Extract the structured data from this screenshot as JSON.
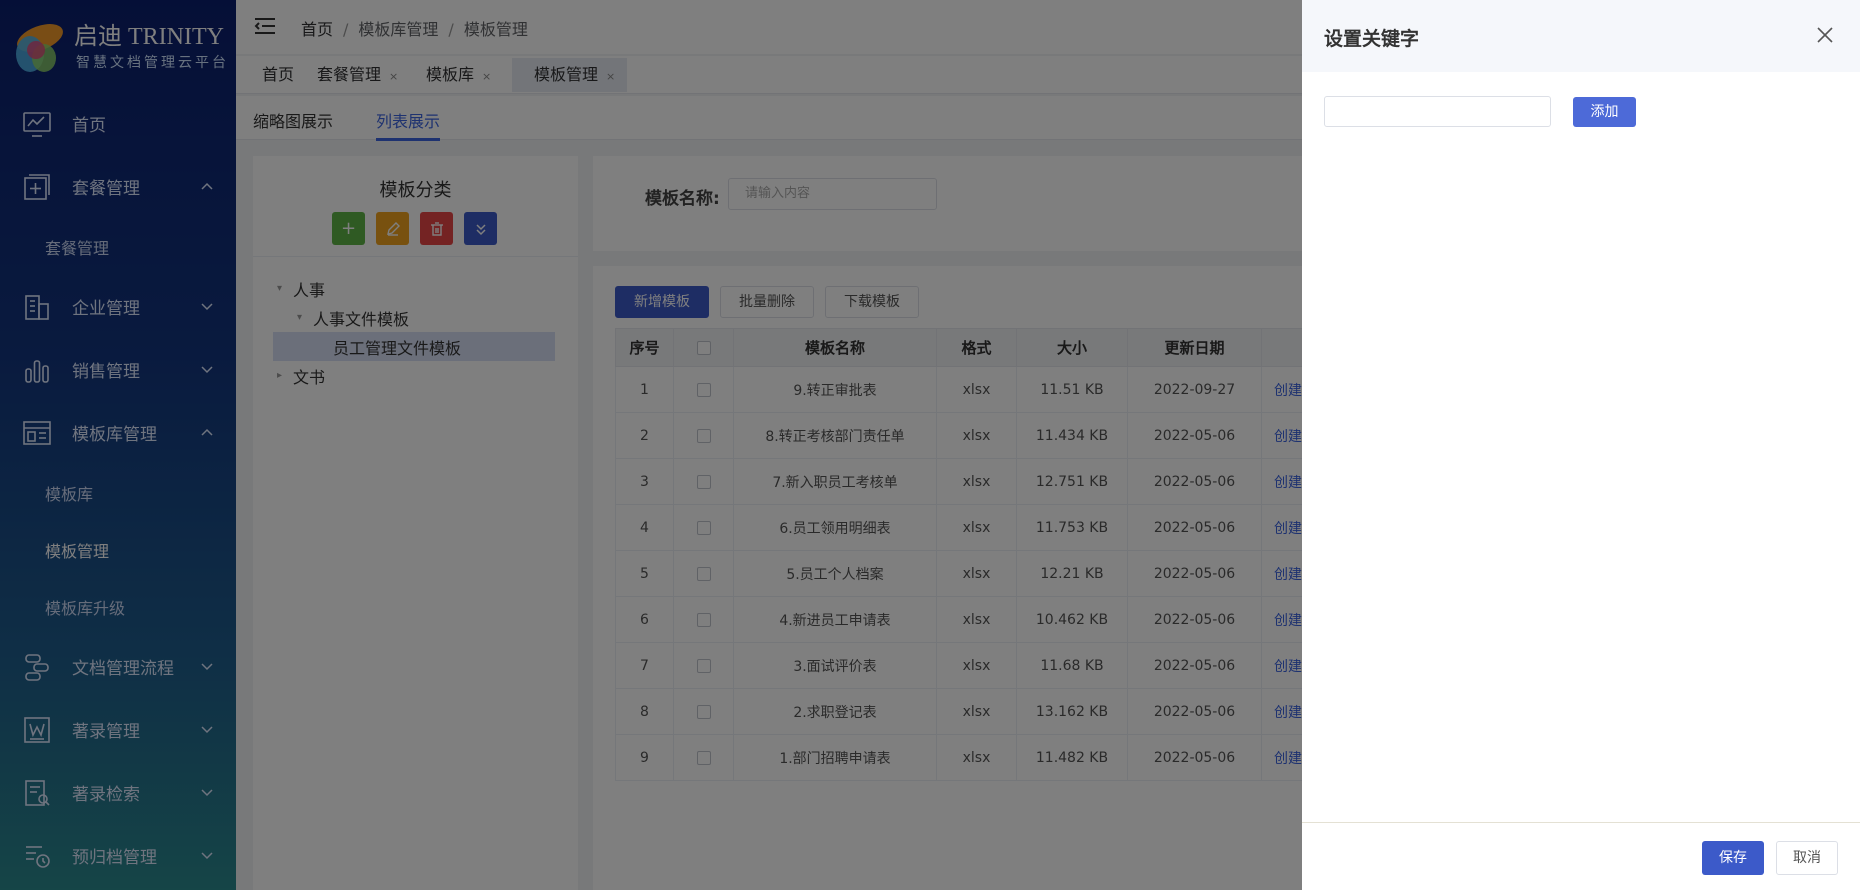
{
  "app": {
    "logo_title": "启迪 TRINITY",
    "logo_subtitle": "智慧文档管理云平台"
  },
  "sidebar": {
    "items": [
      {
        "label": "首页",
        "icon": "monitor-chart-icon"
      },
      {
        "label": "套餐管理",
        "icon": "plus-box-icon",
        "expanded": true
      },
      {
        "label": "套餐管理",
        "sub": true
      },
      {
        "label": "企业管理",
        "icon": "building-icon"
      },
      {
        "label": "销售管理",
        "icon": "bar-chart-icon"
      },
      {
        "label": "模板库管理",
        "icon": "template-icon",
        "expanded": true
      },
      {
        "label": "模板库",
        "sub": true
      },
      {
        "label": "模板管理",
        "sub": true,
        "active": true
      },
      {
        "label": "模板库升级",
        "sub": true
      },
      {
        "label": "文档管理流程",
        "icon": "flow-icon"
      },
      {
        "label": "著录管理",
        "icon": "word-doc-icon"
      },
      {
        "label": "著录检索",
        "icon": "search-doc-icon"
      },
      {
        "label": "预归档管理",
        "icon": "archive-clock-icon"
      }
    ]
  },
  "header": {
    "breadcrumb": [
      "首页",
      "模板库管理",
      "模板管理"
    ]
  },
  "page_tabs": [
    {
      "label": "首页",
      "closable": false
    },
    {
      "label": "套餐管理",
      "closable": true
    },
    {
      "label": "模板库",
      "closable": true
    },
    {
      "label": "模板管理",
      "closable": true,
      "active": true
    }
  ],
  "view_tabs": {
    "thumbnail": "缩略图展示",
    "list": "列表展示"
  },
  "category_panel": {
    "title": "模板分类",
    "tree": [
      {
        "label": "人事",
        "level": 0,
        "caret": "▾"
      },
      {
        "label": "人事文件模板",
        "level": 1,
        "caret": "▾"
      },
      {
        "label": "员工管理文件模板",
        "level": 2,
        "caret": "",
        "selected": true
      },
      {
        "label": "文书",
        "level": 0,
        "caret": "▸"
      }
    ]
  },
  "search": {
    "label": "模板名称:",
    "placeholder": "请输入内容"
  },
  "actions": {
    "add": "新增模板",
    "batch_delete": "批量删除",
    "download": "下载模板"
  },
  "table": {
    "headers": [
      "序号",
      "",
      "模板名称",
      "格式",
      "大小",
      "更新日期",
      ""
    ],
    "rows": [
      [
        "1",
        "9.转正审批表",
        "xlsx",
        "11.51 KB",
        "2022-09-27",
        "创建"
      ],
      [
        "2",
        "8.转正考核部门责任单",
        "xlsx",
        "11.434 KB",
        "2022-05-06",
        "创建"
      ],
      [
        "3",
        "7.新入职员工考核单",
        "xlsx",
        "12.751 KB",
        "2022-05-06",
        "创建"
      ],
      [
        "4",
        "6.员工领用明细表",
        "xlsx",
        "11.753 KB",
        "2022-05-06",
        "创建"
      ],
      [
        "5",
        "5.员工个人档案",
        "xlsx",
        "12.21 KB",
        "2022-05-06",
        "创建"
      ],
      [
        "6",
        "4.新进员工申请表",
        "xlsx",
        "10.462 KB",
        "2022-05-06",
        "创建"
      ],
      [
        "7",
        "3.面试评价表",
        "xlsx",
        "11.68 KB",
        "2022-05-06",
        "创建"
      ],
      [
        "8",
        "2.求职登记表",
        "xlsx",
        "13.162 KB",
        "2022-05-06",
        "创建"
      ],
      [
        "9",
        "1.部门招聘申请表",
        "xlsx",
        "11.482 KB",
        "2022-05-06",
        "创建"
      ]
    ]
  },
  "drawer": {
    "title": "设置关键字",
    "input_value": "",
    "add_label": "添加",
    "save_label": "保存",
    "cancel_label": "取消"
  },
  "colors": {
    "primary": "#3c5ac9",
    "link": "#3c64e0",
    "tool_add": "#5fb547",
    "tool_edit": "#f0a21f",
    "tool_delete": "#e84747",
    "tool_expand": "#3c5ac9"
  }
}
